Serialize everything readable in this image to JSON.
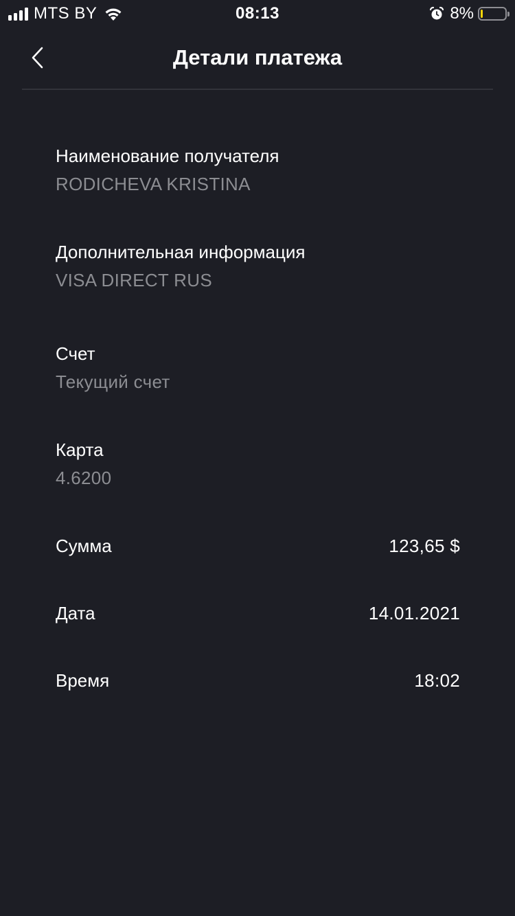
{
  "status_bar": {
    "carrier": "MTS BY",
    "time": "08:13",
    "battery_percent": "8%",
    "battery_level": 0.08,
    "battery_color": "#ffd60a",
    "icons": [
      "signal-bars-icon",
      "wifi-icon",
      "alarm-icon",
      "battery-icon"
    ]
  },
  "nav": {
    "title": "Детали платежа",
    "back_icon": "chevron-left-icon"
  },
  "details": {
    "recipient": {
      "label": "Наименование получателя",
      "value": "RODICHEVA KRISTINA"
    },
    "additional_info": {
      "label": "Дополнительная информация",
      "value": "VISA DIRECT RUS"
    },
    "account": {
      "label": "Счет",
      "value": "Текущий счет"
    },
    "card": {
      "label": "Карта",
      "value": "4.6200"
    }
  },
  "rows": {
    "amount": {
      "label": "Сумма",
      "value": "123,65 $"
    },
    "date": {
      "label": "Дата",
      "value": "14.01.2021"
    },
    "time": {
      "label": "Время",
      "value": "18:02"
    }
  },
  "colors": {
    "background": "#1d1e25",
    "primary_text": "#ffffff",
    "secondary_text": "#8c8d92",
    "divider": "#33343b"
  }
}
